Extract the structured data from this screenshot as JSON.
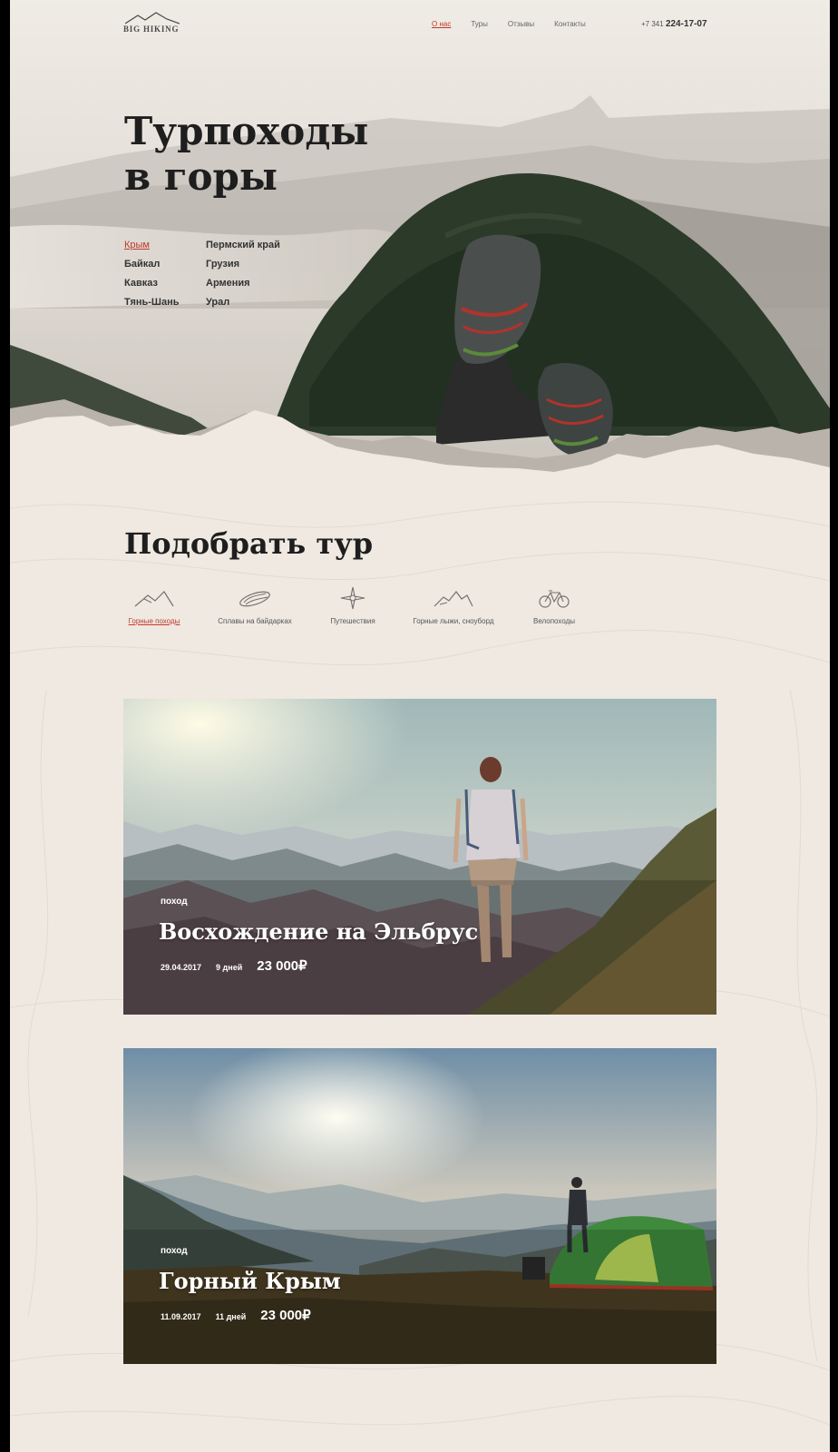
{
  "header": {
    "logo": "BIG HIKING",
    "nav": [
      "О нас",
      "Туры",
      "Отзывы",
      "Контакты"
    ],
    "phone_prefix": "+7 341",
    "phone_number": "224-17-07"
  },
  "hero": {
    "title_line1": "Турпоходы",
    "title_line2": "в горы",
    "regions": [
      "Крым",
      "Пермский край",
      "Байкал",
      "Грузия",
      "Кавказ",
      "Армения",
      "Тянь-Шань",
      "Урал"
    ]
  },
  "picker": {
    "title": "Подобрать тур",
    "categories": [
      {
        "label": "Горные походы",
        "icon": "mountains-icon"
      },
      {
        "label": "Сплавы на байдарках",
        "icon": "kayak-icon"
      },
      {
        "label": "Путешествия",
        "icon": "compass-icon"
      },
      {
        "label": "Горные лыжи, сноуборд",
        "icon": "ski-icon"
      },
      {
        "label": "Велопоходы",
        "icon": "bicycle-icon"
      }
    ]
  },
  "tours": [
    {
      "kind": "поход",
      "title": "Восхождение на Эльбрус",
      "date": "29.04.2017",
      "days": "9 дней",
      "price": "23 000₽"
    },
    {
      "kind": "поход",
      "title": "Горный Крым",
      "date": "11.09.2017",
      "days": "11 дней",
      "price": "23 000₽"
    }
  ],
  "colors": {
    "accent": "#c0392b",
    "background": "#efe9e2",
    "text": "#1e1e1e"
  }
}
